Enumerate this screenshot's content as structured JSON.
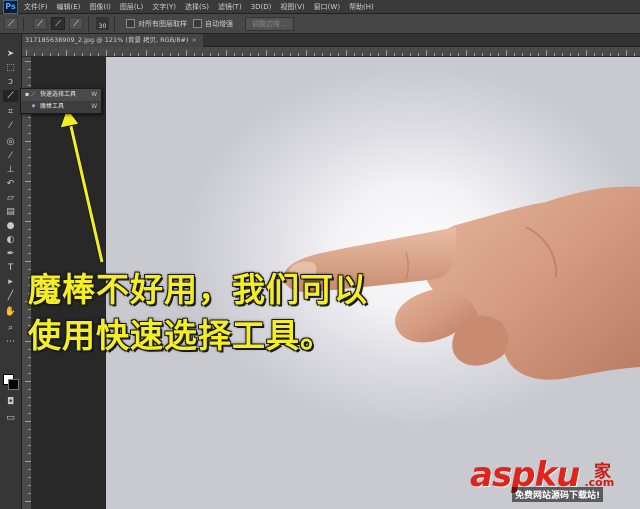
{
  "app": {
    "logo": "Ps"
  },
  "menubar": {
    "items": [
      {
        "label": "文件(F)"
      },
      {
        "label": "编辑(E)"
      },
      {
        "label": "图像(I)"
      },
      {
        "label": "图层(L)"
      },
      {
        "label": "文字(Y)"
      },
      {
        "label": "选择(S)"
      },
      {
        "label": "滤镜(T)"
      },
      {
        "label": "3D(D)"
      },
      {
        "label": "视图(V)"
      },
      {
        "label": "窗口(W)"
      },
      {
        "label": "帮助(H)"
      }
    ]
  },
  "options_bar": {
    "brush_size": "30",
    "sample_all_layers_label": "对所有图层取样",
    "auto_enhance_label": "自动增强",
    "refine_edge_label": "调整边缘..."
  },
  "document": {
    "tab_label": "317185638909_2.jpg @ 121% (背景 拷贝, RGB/8#)",
    "close_glyph": "×"
  },
  "tool_flyout": {
    "items": [
      {
        "label": "快速选择工具",
        "shortcut": "W",
        "selected": true
      },
      {
        "label": "魔棒工具",
        "shortcut": "W",
        "selected": false
      }
    ]
  },
  "caption": {
    "line1": "魔棒不好用，我们可以",
    "line2": "使用快速选择工具。"
  },
  "watermark": {
    "logo": "aspku",
    "logo_suffix": ".com",
    "jia": "家",
    "subtitle": "免费网站源码下载站!"
  },
  "colors": {
    "caption_yellow": "#f4ef25",
    "arrow_yellow": "#f2ee24",
    "watermark_red": "#e0241b"
  }
}
